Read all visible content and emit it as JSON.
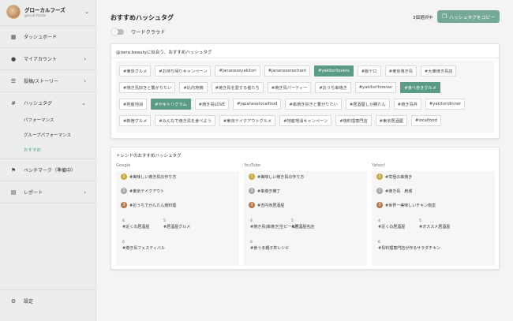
{
  "brand": {
    "name": "グローカルフーズ",
    "sub": "glocal.foods"
  },
  "nav": {
    "dashboard": "ダッシュボード",
    "my_account": "マイアカウント",
    "posts_stories": "投稿/ストーリー",
    "hashtags": "ハッシュタグ",
    "hashtag_sub": [
      "パフォーマンス",
      "グループパフォーマンス",
      "おすすめ"
    ],
    "benchmark": "ベンチマーク（準備中）",
    "report": "レポート",
    "settings": "設定"
  },
  "header": {
    "title": "おすすめハッシュタグ",
    "selected_count": "3個選択中",
    "copy_button": "ハッシュタグをコピー"
  },
  "toggle": {
    "label": "ワードクラウド",
    "on": false
  },
  "recommend_card": {
    "title": "@nera.beautyに似合う、おすすめハッシュタグ",
    "rows": [
      [
        {
          "text": "#東京グルメ",
          "selected": false
        },
        {
          "text": "#お持ち帰りキャンペーン",
          "selected": false
        },
        {
          "text": "#jananeseyakitori",
          "selected": false
        },
        {
          "text": "#jananeserestrant",
          "selected": false
        },
        {
          "text": "#yakitorilovers",
          "selected": true
        },
        {
          "text": "#飯テロ",
          "selected": false
        },
        {
          "text": "#東京焼き鳥",
          "selected": false
        },
        {
          "text": "#大衆焼き鳥店",
          "selected": false
        }
      ],
      [
        {
          "text": "#焼き鳥好きと繋がりたい",
          "selected": false
        },
        {
          "text": "#比内地鶏",
          "selected": false
        },
        {
          "text": "#焼き鳥を愛する者たち",
          "selected": false
        },
        {
          "text": "#焼き鳥パーティー",
          "selected": false
        },
        {
          "text": "#おうち串焼き",
          "selected": false
        },
        {
          "text": "#yakitoriforever",
          "selected": false
        },
        {
          "text": "#食べ歩きグルメ",
          "selected": true
        }
      ],
      [
        {
          "text": "#地産地消",
          "selected": false
        },
        {
          "text": "#ヤキトリグラム",
          "selected": true
        },
        {
          "text": "#焼き鳥LOVE",
          "selected": false
        },
        {
          "text": "#japaneselocalfood",
          "selected": false
        },
        {
          "text": "#串焼き好きと繋がりたい",
          "selected": false
        },
        {
          "text": "#居酒屋しか勝たん",
          "selected": false
        },
        {
          "text": "#焼き鳥丼",
          "selected": false
        },
        {
          "text": "#yakitoridinner",
          "selected": false
        }
      ],
      [
        {
          "text": "#新宿グルメ",
          "selected": false
        },
        {
          "text": "#みんなで焼き鳥を食べよう",
          "selected": false
        },
        {
          "text": "#東京テイクアウトグルメ",
          "selected": false
        },
        {
          "text": "#地産地消キャンペーン",
          "selected": false
        },
        {
          "text": "#焼料理専門店",
          "selected": false
        },
        {
          "text": "#東京居酒屋",
          "selected": false
        },
        {
          "text": "#localfood",
          "selected": false
        }
      ]
    ]
  },
  "trend_card": {
    "title": "トレンドのおすすめハッシュタグ",
    "columns": [
      {
        "source": "Google",
        "top": [
          {
            "rank": "1",
            "tag": "#美味しい焼き鳥の作り方"
          },
          {
            "rank": "2",
            "tag": "#東京テイクアウト"
          },
          {
            "rank": "3",
            "tag": "#おうちでかんたん焼料理"
          }
        ],
        "rest": [
          {
            "rank": "4",
            "tag": "#近くの居酒屋"
          },
          {
            "rank": "5",
            "tag": "#居酒屋グルメ"
          },
          {
            "rank": "6",
            "tag": "#焼き鳥フェスティバル"
          }
        ]
      },
      {
        "source": "YouTube",
        "top": [
          {
            "rank": "1",
            "tag": "#美味しい焼き鳥の作り方"
          },
          {
            "rank": "2",
            "tag": "#串焼き横丁"
          },
          {
            "rank": "3",
            "tag": "#吉円寺居酒屋"
          }
        ],
        "rest": [
          {
            "rank": "4",
            "tag": "#焼き鳥|串焼き|生ビール!!"
          },
          {
            "rank": "5",
            "tag": "#居酒屋名店"
          },
          {
            "rank": "6",
            "tag": "#食うま親子丼レシピ"
          }
        ]
      },
      {
        "source": "Yahoo!",
        "top": [
          {
            "rank": "1",
            "tag": "#究極の串焼き"
          },
          {
            "rank": "2",
            "tag": "#焼き鳥　肩城"
          },
          {
            "rank": "3",
            "tag": "#世界一美味しいチキン南蛮"
          }
        ],
        "rest": [
          {
            "rank": "4",
            "tag": "#近くの居酒屋"
          },
          {
            "rank": "5",
            "tag": "#オススメ居酒屋"
          },
          {
            "rank": "6",
            "tag": "#鳥料理専門店が作るサラダチキン"
          }
        ]
      }
    ]
  },
  "colors": {
    "accent": "#5c9c87",
    "sidebar_bg": "#eceeed"
  },
  "icons": [
    "dashboard-icon",
    "account-icon",
    "posts-icon",
    "hashtag-icon",
    "benchmark-icon",
    "report-icon",
    "settings-icon",
    "copy-icon"
  ]
}
